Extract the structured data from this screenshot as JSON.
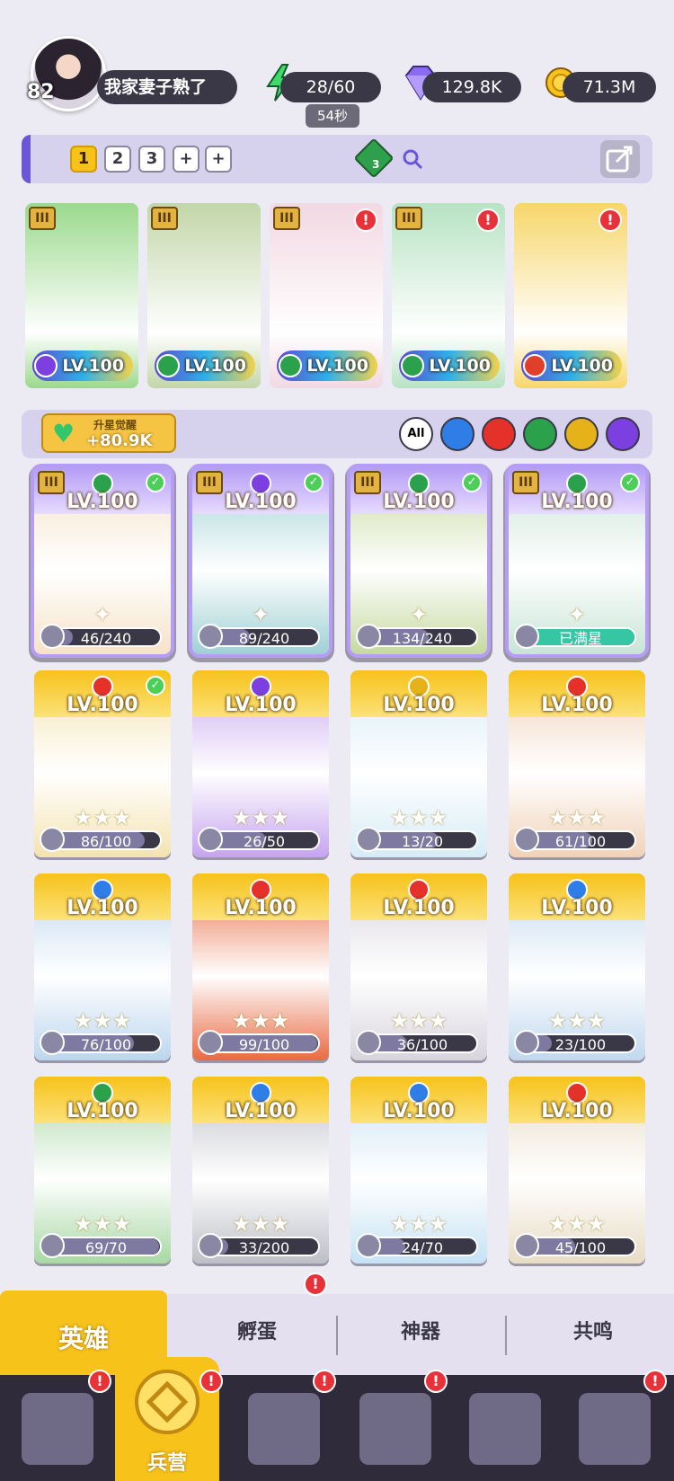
{
  "player": {
    "level": "82",
    "name": "我家妻子熟了"
  },
  "resources": {
    "energy": "28/60",
    "energy_timer": "54秒",
    "gems": "129.8K",
    "coins": "71.3M"
  },
  "team": {
    "tabs": [
      "1",
      "2",
      "3",
      "+",
      "+"
    ],
    "active_tab": "1",
    "gem_count": "3",
    "heroes": [
      {
        "level": "LV.100",
        "rank": "III",
        "element_color": "#7c3fe0",
        "bg": "#9bd98c",
        "alert": false
      },
      {
        "level": "LV.100",
        "rank": "III",
        "element_color": "#2aa14a",
        "bg": "#c2d6a8",
        "alert": false
      },
      {
        "level": "LV.100",
        "rank": "III",
        "element_color": "#2aa14a",
        "bg": "#f2d8e2",
        "alert": true
      },
      {
        "level": "LV.100",
        "rank": "III",
        "element_color": "#2aa14a",
        "bg": "#b7e3c3",
        "alert": true
      },
      {
        "level": "LV.100",
        "rank": "",
        "element_color": "#e0402a",
        "bg": "#f7d66a",
        "alert": true
      }
    ]
  },
  "awakening": {
    "label": "升星觉醒",
    "value": "+80.9K"
  },
  "filters": [
    "All",
    "water",
    "fire",
    "wind",
    "light",
    "dark"
  ],
  "filter_colors": {
    "water": "#2f7ee8",
    "fire": "#e4322a",
    "wind": "#2aa14a",
    "light": "#e6b21a",
    "dark": "#7c3fe0"
  },
  "heroes": [
    {
      "level": "LV.100",
      "progress": "46/240",
      "fraction": 0.19,
      "rank": "III",
      "element_color": "#2aa14a",
      "check": true,
      "style": "purple",
      "bg": "#f6e2c8"
    },
    {
      "level": "LV.100",
      "progress": "89/240",
      "fraction": 0.37,
      "rank": "III",
      "element_color": "#7c3fe0",
      "check": true,
      "style": "purple",
      "bg": "#9fd0d4"
    },
    {
      "level": "LV.100",
      "progress": "134/240",
      "fraction": 0.56,
      "rank": "III",
      "element_color": "#2aa14a",
      "check": true,
      "style": "purple",
      "bg": "#c6d9a0"
    },
    {
      "level": "LV.100",
      "progress": "已满星",
      "fraction": 1.0,
      "rank": "III",
      "element_color": "#2aa14a",
      "check": true,
      "style": "purple",
      "bg": "#c8e4d6"
    },
    {
      "level": "LV.100",
      "progress": "86/100",
      "fraction": 0.86,
      "rank": "",
      "element_color": "#e4322a",
      "check": true,
      "style": "gold",
      "bg": "#f4e3b0"
    },
    {
      "level": "LV.100",
      "progress": "26/50",
      "fraction": 0.52,
      "rank": "",
      "element_color": "#7c3fe0",
      "check": false,
      "style": "gold",
      "bg": "#c6a4f0"
    },
    {
      "level": "LV.100",
      "progress": "13/20",
      "fraction": 0.65,
      "rank": "",
      "element_color": "#e6b21a",
      "check": false,
      "style": "gold",
      "bg": "#d6ecf6"
    },
    {
      "level": "LV.100",
      "progress": "61/100",
      "fraction": 0.61,
      "rank": "",
      "element_color": "#e4322a",
      "check": false,
      "style": "gold",
      "bg": "#f0d2b8"
    },
    {
      "level": "LV.100",
      "progress": "76/100",
      "fraction": 0.76,
      "rank": "",
      "element_color": "#2f7ee8",
      "check": false,
      "style": "gold",
      "bg": "#bcd6ee"
    },
    {
      "level": "LV.100",
      "progress": "99/100",
      "fraction": 0.99,
      "rank": "",
      "element_color": "#e4322a",
      "check": false,
      "style": "gold",
      "bg": "#e86a42"
    },
    {
      "level": "LV.100",
      "progress": "36/100",
      "fraction": 0.36,
      "rank": "",
      "element_color": "#e4322a",
      "check": false,
      "style": "gold",
      "bg": "#d8d4dc"
    },
    {
      "level": "LV.100",
      "progress": "23/100",
      "fraction": 0.23,
      "rank": "",
      "element_color": "#2f7ee8",
      "check": false,
      "style": "gold",
      "bg": "#c0d8ee"
    },
    {
      "level": "LV.100",
      "progress": "69/70",
      "fraction": 0.99,
      "rank": "",
      "element_color": "#2aa14a",
      "check": false,
      "style": "gold",
      "bg": "#a8d8a4"
    },
    {
      "level": "LV.100",
      "progress": "33/200",
      "fraction": 0.17,
      "rank": "",
      "element_color": "#2f7ee8",
      "check": false,
      "style": "gold",
      "bg": "#bdbfc6"
    },
    {
      "level": "LV.100",
      "progress": "24/70",
      "fraction": 0.34,
      "rank": "",
      "element_color": "#2f7ee8",
      "check": false,
      "style": "gold",
      "bg": "#c6e2f4"
    },
    {
      "level": "LV.100",
      "progress": "45/100",
      "fraction": 0.45,
      "rank": "",
      "element_color": "#e4322a",
      "check": false,
      "style": "gold",
      "bg": "#e8dcc4"
    }
  ],
  "subtabs": [
    {
      "label": "英雄",
      "active": true,
      "alert": false
    },
    {
      "label": "孵蛋",
      "active": false,
      "alert": true
    },
    {
      "label": "神器",
      "active": false,
      "alert": false
    },
    {
      "label": "共鸣",
      "active": false,
      "alert": false
    }
  ],
  "nav": {
    "active_label": "兵营",
    "items": [
      "cards",
      "barracks",
      "journal",
      "castle",
      "guild",
      "banner"
    ]
  },
  "colors": {
    "accent_gold": "#f7c21a",
    "accent_purple": "#6b56d8",
    "alert_red": "#e8323a"
  }
}
